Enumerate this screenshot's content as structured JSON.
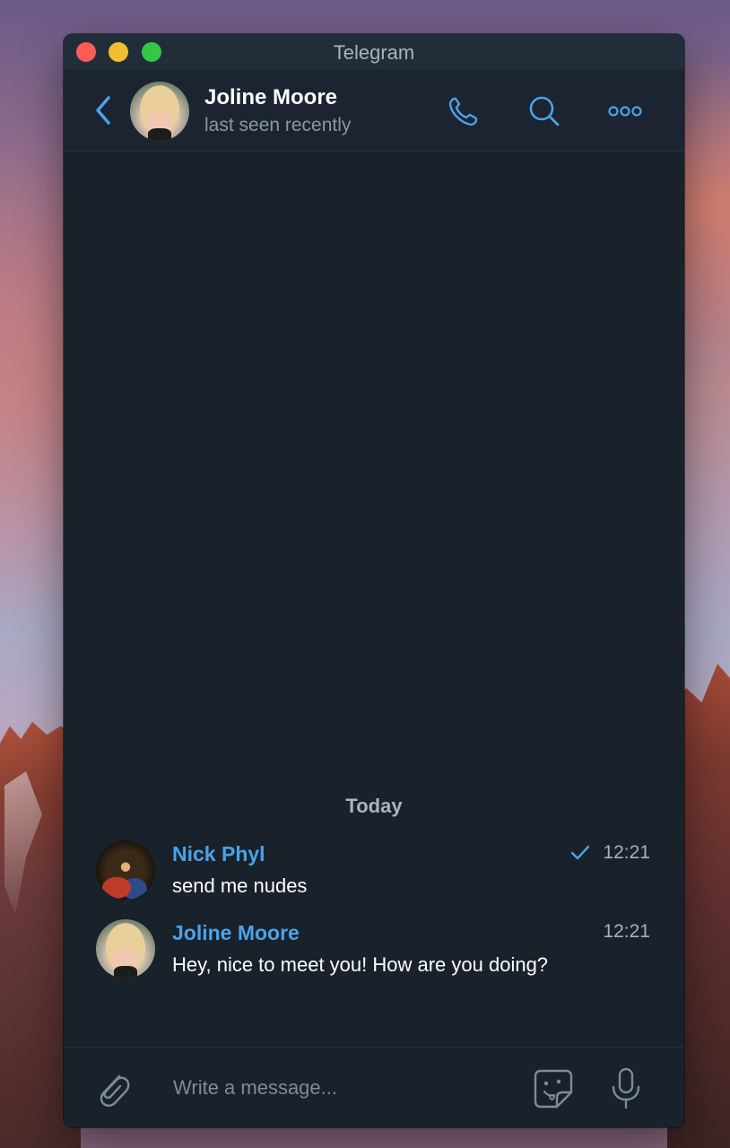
{
  "window": {
    "title": "Telegram"
  },
  "header": {
    "contact_name": "Joline Moore",
    "status": "last seen recently",
    "icons": {
      "back": "chevron-left-icon",
      "call": "phone-icon",
      "search": "search-icon",
      "more": "more-icon"
    }
  },
  "chat": {
    "date_label": "Today",
    "messages": [
      {
        "sender": "Nick Phyl",
        "text": "send me nudes",
        "time": "12:21",
        "read_check": true
      },
      {
        "sender": "Joline Moore",
        "text": "Hey, nice to meet you! How are you doing?",
        "time": "12:21",
        "read_check": false
      }
    ]
  },
  "composer": {
    "placeholder": "Write a message...",
    "icons": {
      "attach": "paperclip-icon",
      "sticker": "sticker-icon",
      "mic": "microphone-icon"
    }
  },
  "colors": {
    "accent": "#4aa3e8",
    "window_bg": "#19212b",
    "titlebar_bg": "#222d3a",
    "close": "#fd5b58",
    "minimize": "#f0bf2f",
    "maximize": "#33c748"
  }
}
